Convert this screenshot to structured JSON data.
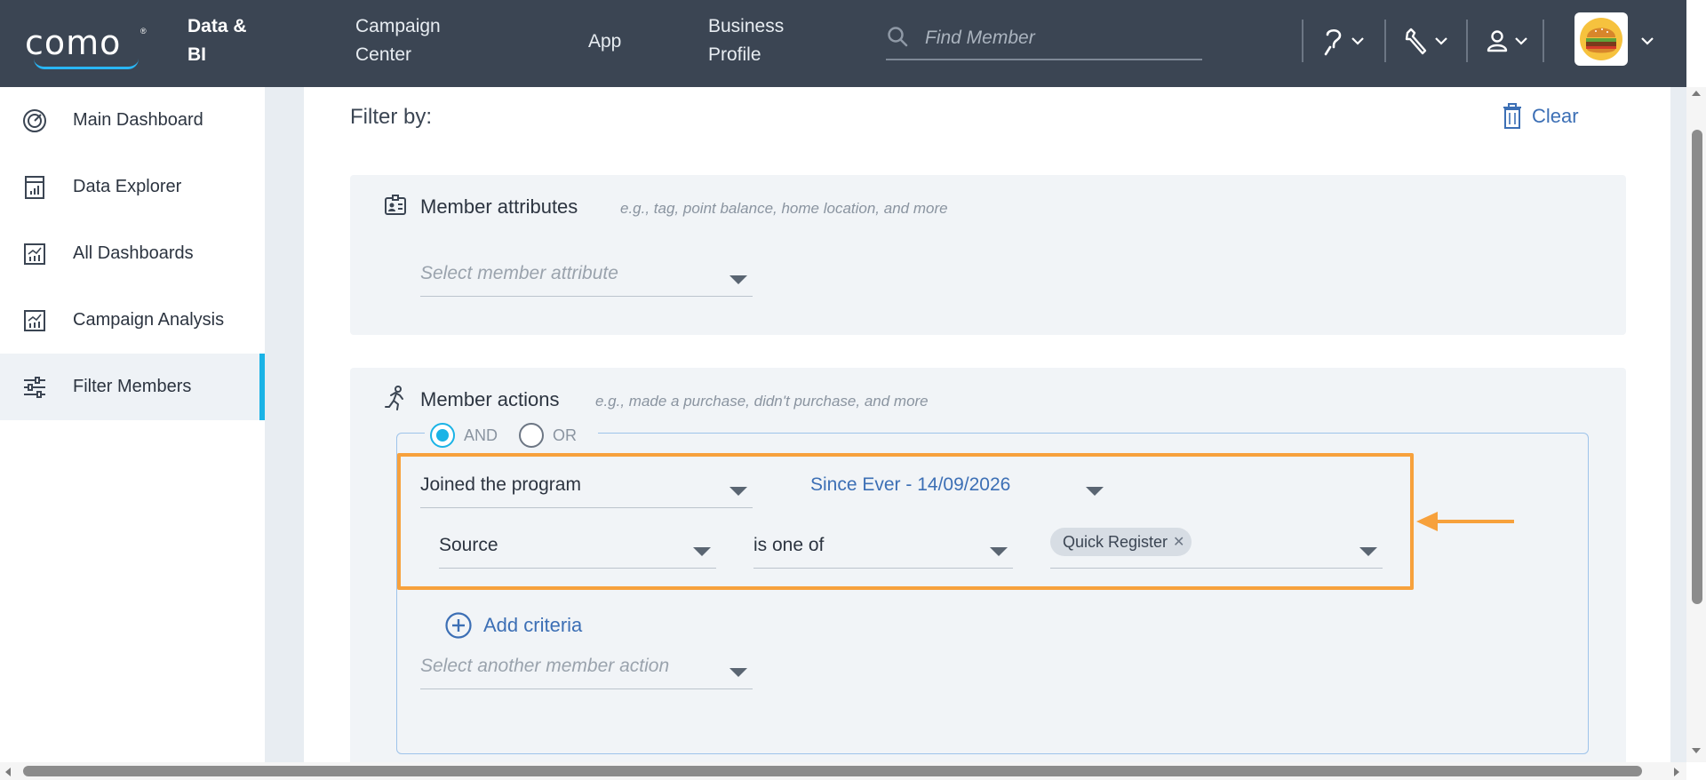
{
  "header": {
    "logo_text": "como",
    "logo_reg": "®",
    "nav": [
      {
        "line1": "Data &",
        "line2": "BI"
      },
      {
        "line1": "Campaign",
        "line2": "Center"
      },
      {
        "line1": "App",
        "line2": ""
      },
      {
        "line1": "Business",
        "line2": "Profile"
      }
    ],
    "search_placeholder": "Find Member"
  },
  "sidebar": {
    "items": [
      {
        "label": "Main Dashboard",
        "icon": "gauge-icon"
      },
      {
        "label": "Data Explorer",
        "icon": "calculator-chart-icon"
      },
      {
        "label": "All Dashboards",
        "icon": "chart-icon"
      },
      {
        "label": "Campaign Analysis",
        "icon": "chart-icon"
      },
      {
        "label": "Filter Members",
        "icon": "sliders-icon",
        "active": true
      }
    ]
  },
  "main": {
    "filter_title": "Filter by:",
    "clear_label": "Clear",
    "attributes": {
      "title": "Member attributes",
      "hint": "e.g., tag, point balance, home location, and more",
      "select_placeholder": "Select member attribute"
    },
    "actions": {
      "title": "Member actions",
      "hint": "e.g., made a purchase, didn't purchase, and more",
      "and_label": "AND",
      "or_label": "OR",
      "action_value": "Joined the program",
      "date_range": "Since Ever - 14/09/2026",
      "field_value": "Source",
      "operator_value": "is one of",
      "chip_label": "Quick Register",
      "chip_remove": "✕",
      "add_criteria_label": "Add criteria",
      "another_action_placeholder": "Select another member action"
    }
  },
  "colors": {
    "topbar": "#3b4553",
    "accent": "#1ab3e6",
    "link": "#3c6fb5",
    "highlight": "#f7a13c"
  }
}
